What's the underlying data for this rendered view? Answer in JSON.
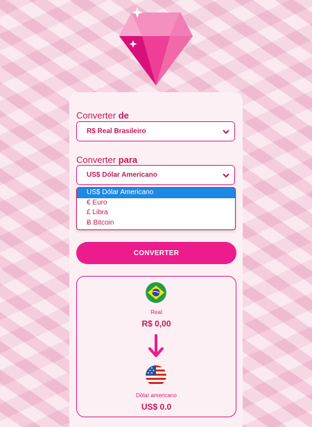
{
  "form": {
    "from_label_prefix": "Converter ",
    "from_label_bold": "de",
    "from_selected": "R$ Real Brasileiro",
    "to_label_prefix": "Converter ",
    "to_label_bold": "para",
    "to_selected": "US$ Dólar Americano",
    "to_options": [
      {
        "label": "US$ Dólar Americano",
        "selected": true
      },
      {
        "label": "€ Euro",
        "selected": false
      },
      {
        "label": "£ Libra",
        "selected": false
      },
      {
        "label": "Ƀ Bitcoin",
        "selected": false
      }
    ],
    "convert_button": "CONVERTER"
  },
  "result": {
    "from_currency_name": "Real",
    "from_value": "R$ 0,00",
    "to_currency_name": "Dólar americano",
    "to_value": "US$ 0.0"
  },
  "icons": {
    "logo": "diamond-icon",
    "from_flag": "brazil-flag-icon",
    "to_flag": "usa-flag-icon",
    "arrow": "arrow-down-icon"
  },
  "colors": {
    "accent": "#ec1c8c",
    "text": "#c2185b",
    "selected_option": "#1e88e5"
  }
}
